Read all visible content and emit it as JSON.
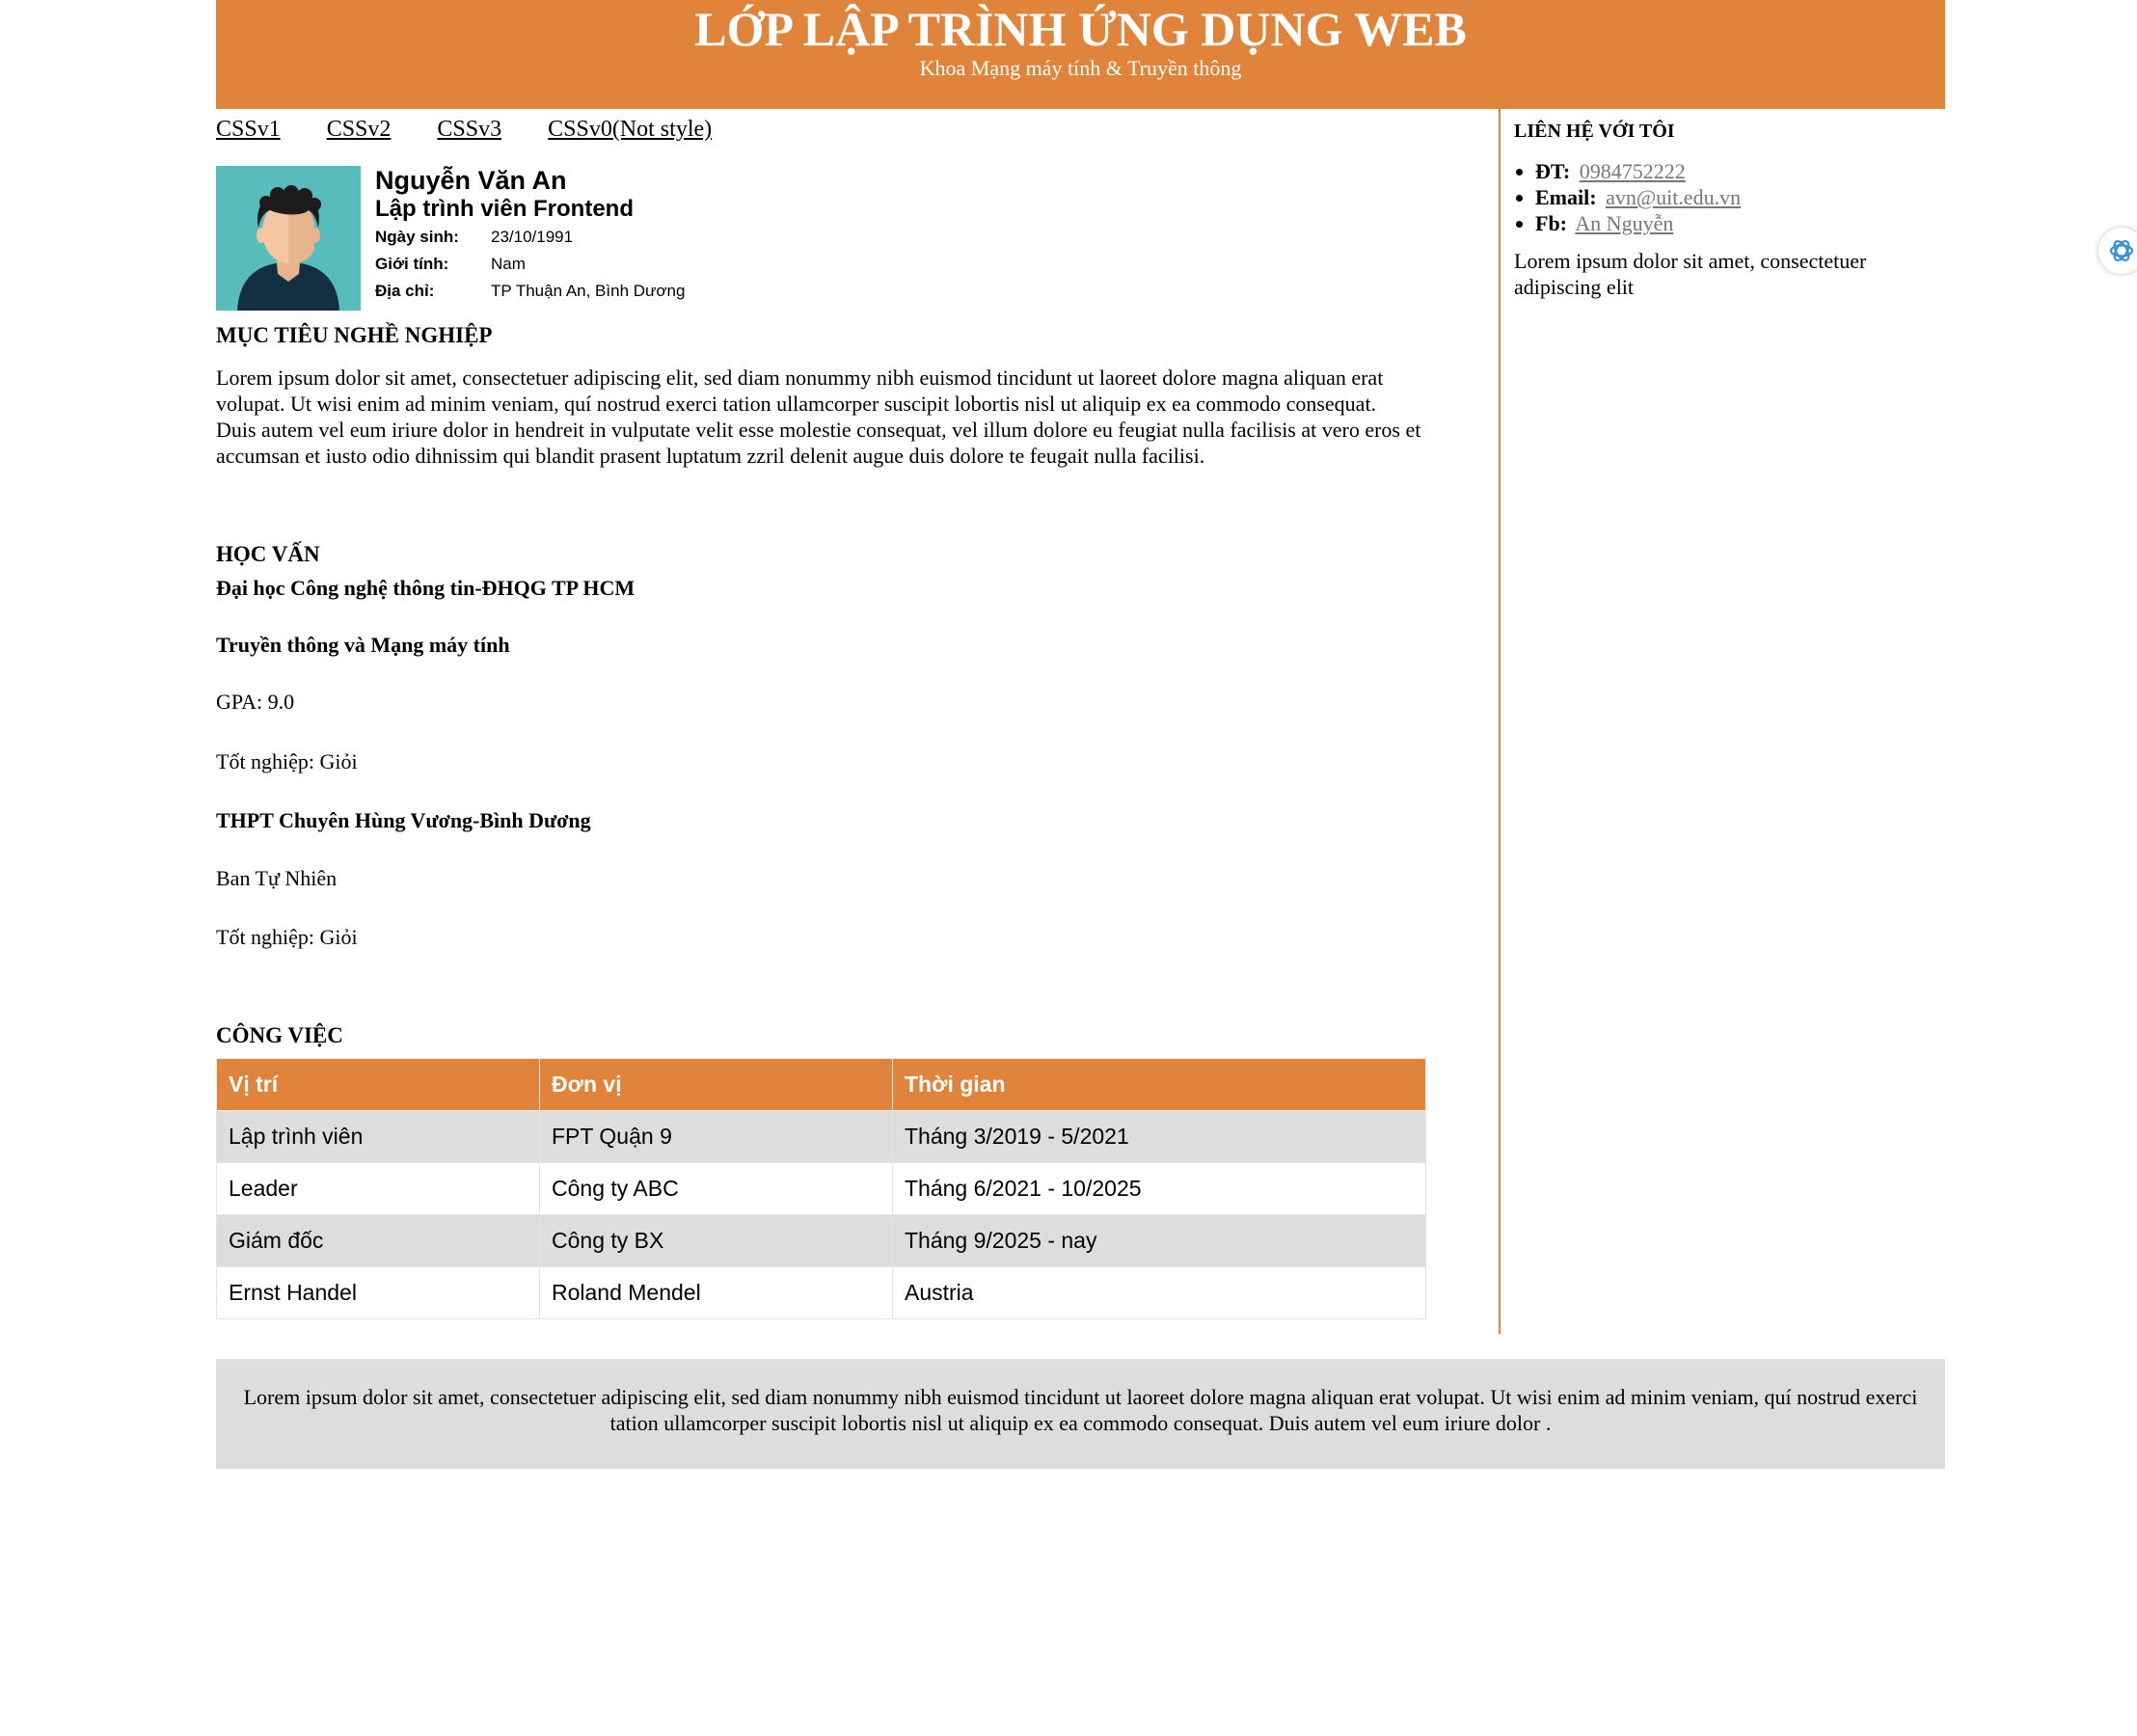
{
  "header": {
    "title": "LỚP LẬP TRÌNH ỨNG DỤNG WEB",
    "subtitle": "Khoa Mạng máy tính & Truyền thông"
  },
  "nav": [
    "CSSv1",
    "CSSv2",
    "CSSv3",
    "CSSv0(Not style)"
  ],
  "profile": {
    "name": "Nguyễn Văn An",
    "role": "Lập trình viên Frontend",
    "dob_label": "Ngày sinh:",
    "dob": "23/10/1991",
    "gender_label": "Giới tính:",
    "gender": "Nam",
    "address_label": "Địa chỉ:",
    "address": "TP Thuận An, Bình Dương"
  },
  "objective": {
    "heading": "MỤC TIÊU NGHỀ NGHIỆP",
    "text": "Lorem ipsum dolor sit amet, consectetuer adipiscing elit, sed diam nonummy nibh euismod tincidunt ut laoreet dolore magna aliquan erat volupat. Ut wisi enim ad minim veniam, quí nostrud exerci tation ullamcorper suscipit lobortis nisl ut aliquip ex ea commodo consequat. Duis autem vel eum iriure dolor in hendreit in vulputate velit esse molestie consequat, vel illum dolore eu feugiat nulla facilisis at vero eros et accumsan et iusto odio dihnissim qui blandit prasent luptatum zzril delenit augue duis dolore te feugait nulla facilisi."
  },
  "education": {
    "heading": "HỌC VẤN",
    "university": "Đại học Công nghệ thông tin-ĐHQG TP HCM",
    "major": "Truyền thông và Mạng máy tính",
    "gpa": "GPA: 9.0",
    "grad1": "Tốt nghiệp: Giỏi",
    "highschool": "THPT Chuyên Hùng Vương-Bình Dương",
    "track": "Ban Tự Nhiên",
    "grad2": "Tốt nghiệp: Giỏi"
  },
  "jobs": {
    "heading": "CÔNG VIỆC",
    "columns": [
      "Vị trí",
      "Đơn vị",
      "Thời gian"
    ],
    "rows": [
      [
        "Lập trình viên",
        "FPT Quận 9",
        "Tháng 3/2019 - 5/2021"
      ],
      [
        "Leader",
        "Công ty ABC",
        "Tháng 6/2021 - 10/2025"
      ],
      [
        "Giám đốc",
        "Công ty BX",
        "Tháng 9/2025 - nay"
      ],
      [
        "Ernst Handel",
        "Roland Mendel",
        "Austria"
      ]
    ]
  },
  "contact": {
    "heading": "LIÊN HỆ VỚI TÔI",
    "phone_label": "ĐT:",
    "phone": "0984752222",
    "email_label": "Email:",
    "email": "avn@uit.edu.vn",
    "fb_label": "Fb:",
    "fb": "An Nguyễn",
    "text": "Lorem ipsum dolor sit amet, consectetuer adipiscing elit"
  },
  "footer": {
    "text": "Lorem ipsum dolor sit amet, consectetuer adipiscing elit, sed diam nonummy nibh euismod tincidunt ut laoreet dolore magna aliquan erat volupat. Ut wisi enim ad minim veniam, quí nostrud exerci tation ullamcorper suscipit lobortis nisl ut aliquip ex ea commodo consequat. Duis autem vel eum iriure dolor ."
  },
  "colors": {
    "accent": "#e0843b",
    "stripe": "#dddddd",
    "avatar_bg": "#58bcbc"
  },
  "icons": {
    "avatar": "person-avatar-icon",
    "assistant": "assistant-logo-icon"
  }
}
